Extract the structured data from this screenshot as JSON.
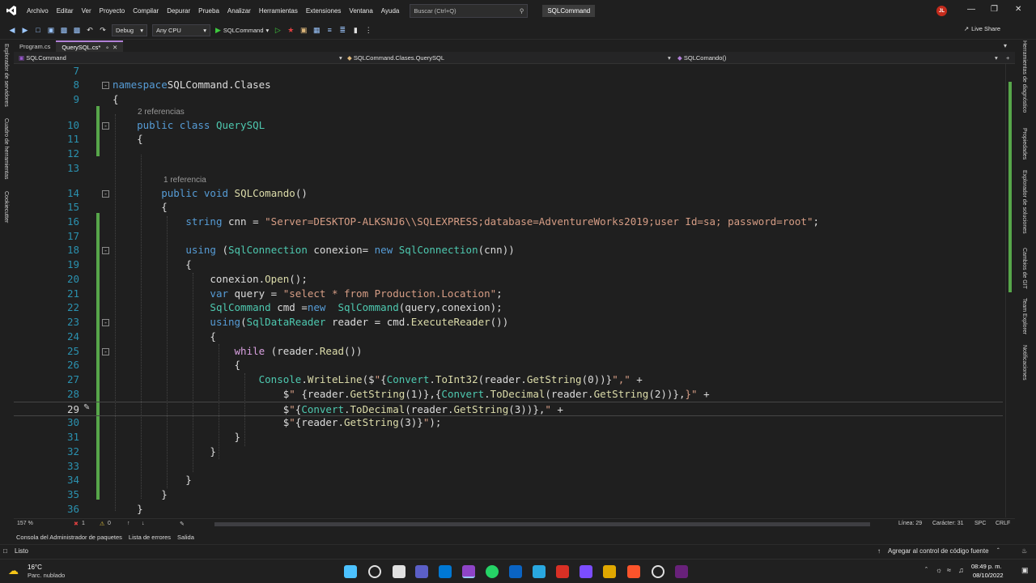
{
  "menu": [
    "Archivo",
    "Editar",
    "Ver",
    "Proyecto",
    "Compilar",
    "Depurar",
    "Prueba",
    "Analizar",
    "Herramientas",
    "Extensiones",
    "Ventana",
    "Ayuda"
  ],
  "search": {
    "placeholder": "Buscar (Ctrl+Q)"
  },
  "solution_name": "SQLCommand",
  "user_initials": "JL",
  "toolbar": {
    "config": "Debug",
    "platform": "Any CPU",
    "run_label": "SQLCommand",
    "live_share": "Live Share"
  },
  "left_panels": [
    "Explorador de servidores",
    "Cuadro de herramientas",
    "Cookiecutter"
  ],
  "right_panels": [
    "Herramientas de diagnóstico",
    "Propiedades",
    "Explorador de soluciones",
    "Cambios de GIT",
    "Team Explorer",
    "Notificaciones"
  ],
  "doc_tabs": [
    {
      "label": "Program.cs",
      "active": false
    },
    {
      "label": "QuerySQL.cs*",
      "active": true
    }
  ],
  "nav": {
    "project": "SQLCommand",
    "type": "SQLCommand.Clases.QuerySQL",
    "member": "SQLComando()"
  },
  "code": {
    "lens1": "2 referencias",
    "lens2": "1 referencia",
    "lines": [
      {
        "n": "7"
      },
      {
        "n": "8",
        "parts": [
          [
            "kw",
            "namespace"
          ],
          [
            "",
            "SQLCommand.Clases"
          ]
        ]
      },
      {
        "n": "9",
        "parts": [
          [
            "",
            "{"
          ]
        ]
      },
      {
        "n": "10",
        "parts": [
          [
            "",
            "    "
          ],
          [
            "kw",
            "public class"
          ],
          [
            "",
            ""
          ],
          [
            "ty",
            "QuerySQL"
          ]
        ]
      },
      {
        "n": "11",
        "parts": [
          [
            "",
            "    {"
          ]
        ]
      },
      {
        "n": "12"
      },
      {
        "n": "13"
      },
      {
        "n": "14",
        "parts": [
          [
            "",
            "        "
          ],
          [
            "kw",
            "public void"
          ],
          [
            "",
            ""
          ],
          [
            "mth",
            "SQLComando"
          ],
          [
            "",
            "()"
          ]
        ]
      },
      {
        "n": "15",
        "parts": [
          [
            "",
            "        {"
          ]
        ]
      },
      {
        "n": "16",
        "parts": [
          [
            "",
            "            "
          ],
          [
            "kw",
            "string"
          ],
          [
            "",
            " cnn = "
          ],
          [
            "str",
            "\"Server=DESKTOP-ALKSNJ6\\\\SQLEXPRESS;database=AdventureWorks2019;user Id=sa; password=root\""
          ],
          [
            "",
            ";"
          ]
        ]
      },
      {
        "n": "17"
      },
      {
        "n": "18",
        "parts": [
          [
            "",
            "            "
          ],
          [
            "kw",
            "using"
          ],
          [
            "",
            " ("
          ],
          [
            "ty",
            "SqlConnection"
          ],
          [
            "",
            " conexion= "
          ],
          [
            "kw",
            "new"
          ],
          [
            "",
            ""
          ],
          [
            "ty",
            "SqlConnection"
          ],
          [
            "",
            "(cnn))"
          ]
        ]
      },
      {
        "n": "19",
        "parts": [
          [
            "",
            "            {"
          ]
        ]
      },
      {
        "n": "20",
        "parts": [
          [
            "",
            "                conexion."
          ],
          [
            "mth",
            "Open"
          ],
          [
            "",
            "();"
          ]
        ]
      },
      {
        "n": "21",
        "parts": [
          [
            "",
            "                "
          ],
          [
            "kw",
            "var"
          ],
          [
            "",
            " query = "
          ],
          [
            "str",
            "\"select * from Production.Location\""
          ],
          [
            "",
            ";"
          ]
        ]
      },
      {
        "n": "22",
        "parts": [
          [
            "",
            "                "
          ],
          [
            "ty",
            "SqlCommand"
          ],
          [
            "",
            " cmd ="
          ],
          [
            "kw",
            "new"
          ],
          [
            "",
            "  "
          ],
          [
            "ty",
            "SqlCommand"
          ],
          [
            "",
            "(query,conexion);"
          ]
        ]
      },
      {
        "n": "23",
        "parts": [
          [
            "",
            "                "
          ],
          [
            "kw",
            "using"
          ],
          [
            "",
            "("
          ],
          [
            "ty",
            "SqlDataReader"
          ],
          [
            "",
            " reader = cmd."
          ],
          [
            "mth",
            "ExecuteReader"
          ],
          [
            "",
            "())"
          ]
        ]
      },
      {
        "n": "24",
        "parts": [
          [
            "",
            "                {"
          ]
        ]
      },
      {
        "n": "25",
        "parts": [
          [
            "",
            "                    "
          ],
          [
            "ctl",
            "while"
          ],
          [
            "",
            " (reader."
          ],
          [
            "mth",
            "Read"
          ],
          [
            "",
            "())"
          ]
        ]
      },
      {
        "n": "26",
        "parts": [
          [
            "",
            "                    {"
          ]
        ]
      },
      {
        "n": "27",
        "parts": [
          [
            "",
            "                        "
          ],
          [
            "ty",
            "Console"
          ],
          [
            "",
            "."
          ],
          [
            "mth",
            "WriteLine"
          ],
          [
            "",
            "($"
          ],
          [
            "str",
            "\""
          ],
          [
            "",
            "{"
          ],
          [
            "ty",
            "Convert"
          ],
          [
            "",
            "."
          ],
          [
            "mth",
            "ToInt32"
          ],
          [
            "",
            "(reader."
          ],
          [
            "mth",
            "GetString"
          ],
          [
            "",
            "(0))}"
          ],
          [
            "str",
            "\",\""
          ],
          [
            "",
            " +"
          ]
        ]
      },
      {
        "n": "28",
        "parts": [
          [
            "",
            "                            $"
          ],
          [
            "str",
            "\" "
          ],
          [
            "",
            "{reader."
          ],
          [
            "mth",
            "GetString"
          ],
          [
            "",
            "(1)},{"
          ],
          [
            "ty",
            "Convert"
          ],
          [
            "",
            "."
          ],
          [
            "mth",
            "ToDecimal"
          ],
          [
            "",
            "(reader."
          ],
          [
            "mth",
            "GetString"
          ],
          [
            "",
            "(2))},"
          ],
          [
            "str",
            "}\""
          ],
          [
            "",
            " +"
          ]
        ]
      },
      {
        "n": "29",
        "parts": [
          [
            "",
            "                            $"
          ],
          [
            "str",
            "\""
          ],
          [
            "",
            "{"
          ],
          [
            "ty",
            "Convert"
          ],
          [
            "",
            "."
          ],
          [
            "mth",
            "ToDecimal"
          ],
          [
            "",
            "(reader."
          ],
          [
            "mth",
            "GetString"
          ],
          [
            "",
            "(3))},"
          ],
          [
            "str",
            "\""
          ],
          [
            "",
            " +"
          ]
        ]
      },
      {
        "n": "30",
        "parts": [
          [
            "",
            "                            $"
          ],
          [
            "str",
            "\""
          ],
          [
            "",
            "{reader."
          ],
          [
            "mth",
            "GetString"
          ],
          [
            "",
            "(3)}"
          ],
          [
            "str",
            "\""
          ],
          [
            "",
            ");"
          ]
        ]
      },
      {
        "n": "31",
        "parts": [
          [
            "",
            "                    }"
          ]
        ]
      },
      {
        "n": "32",
        "parts": [
          [
            "",
            "                }"
          ]
        ]
      },
      {
        "n": "33"
      },
      {
        "n": "34",
        "parts": [
          [
            "",
            "            }"
          ]
        ]
      },
      {
        "n": "35",
        "parts": [
          [
            "",
            "        }"
          ]
        ]
      },
      {
        "n": "36",
        "parts": [
          [
            "",
            "    }"
          ]
        ]
      }
    ]
  },
  "editor_status": {
    "zoom": "157 %",
    "errors": "1",
    "warnings": "0",
    "line": "Línea: 29",
    "char": "Carácter: 31",
    "spc": "SPC",
    "crlf": "CRLF"
  },
  "tool_tabs": [
    "Consola del Administrador de paquetes",
    "Lista de errores",
    "Salida"
  ],
  "status": {
    "ready": "Listo",
    "source_control": "Agregar al control de código fuente"
  },
  "taskbar": {
    "temp": "16°C",
    "weather": "Parc. nublado",
    "time": "08:49 p. m.",
    "date": "08/10/2022"
  }
}
